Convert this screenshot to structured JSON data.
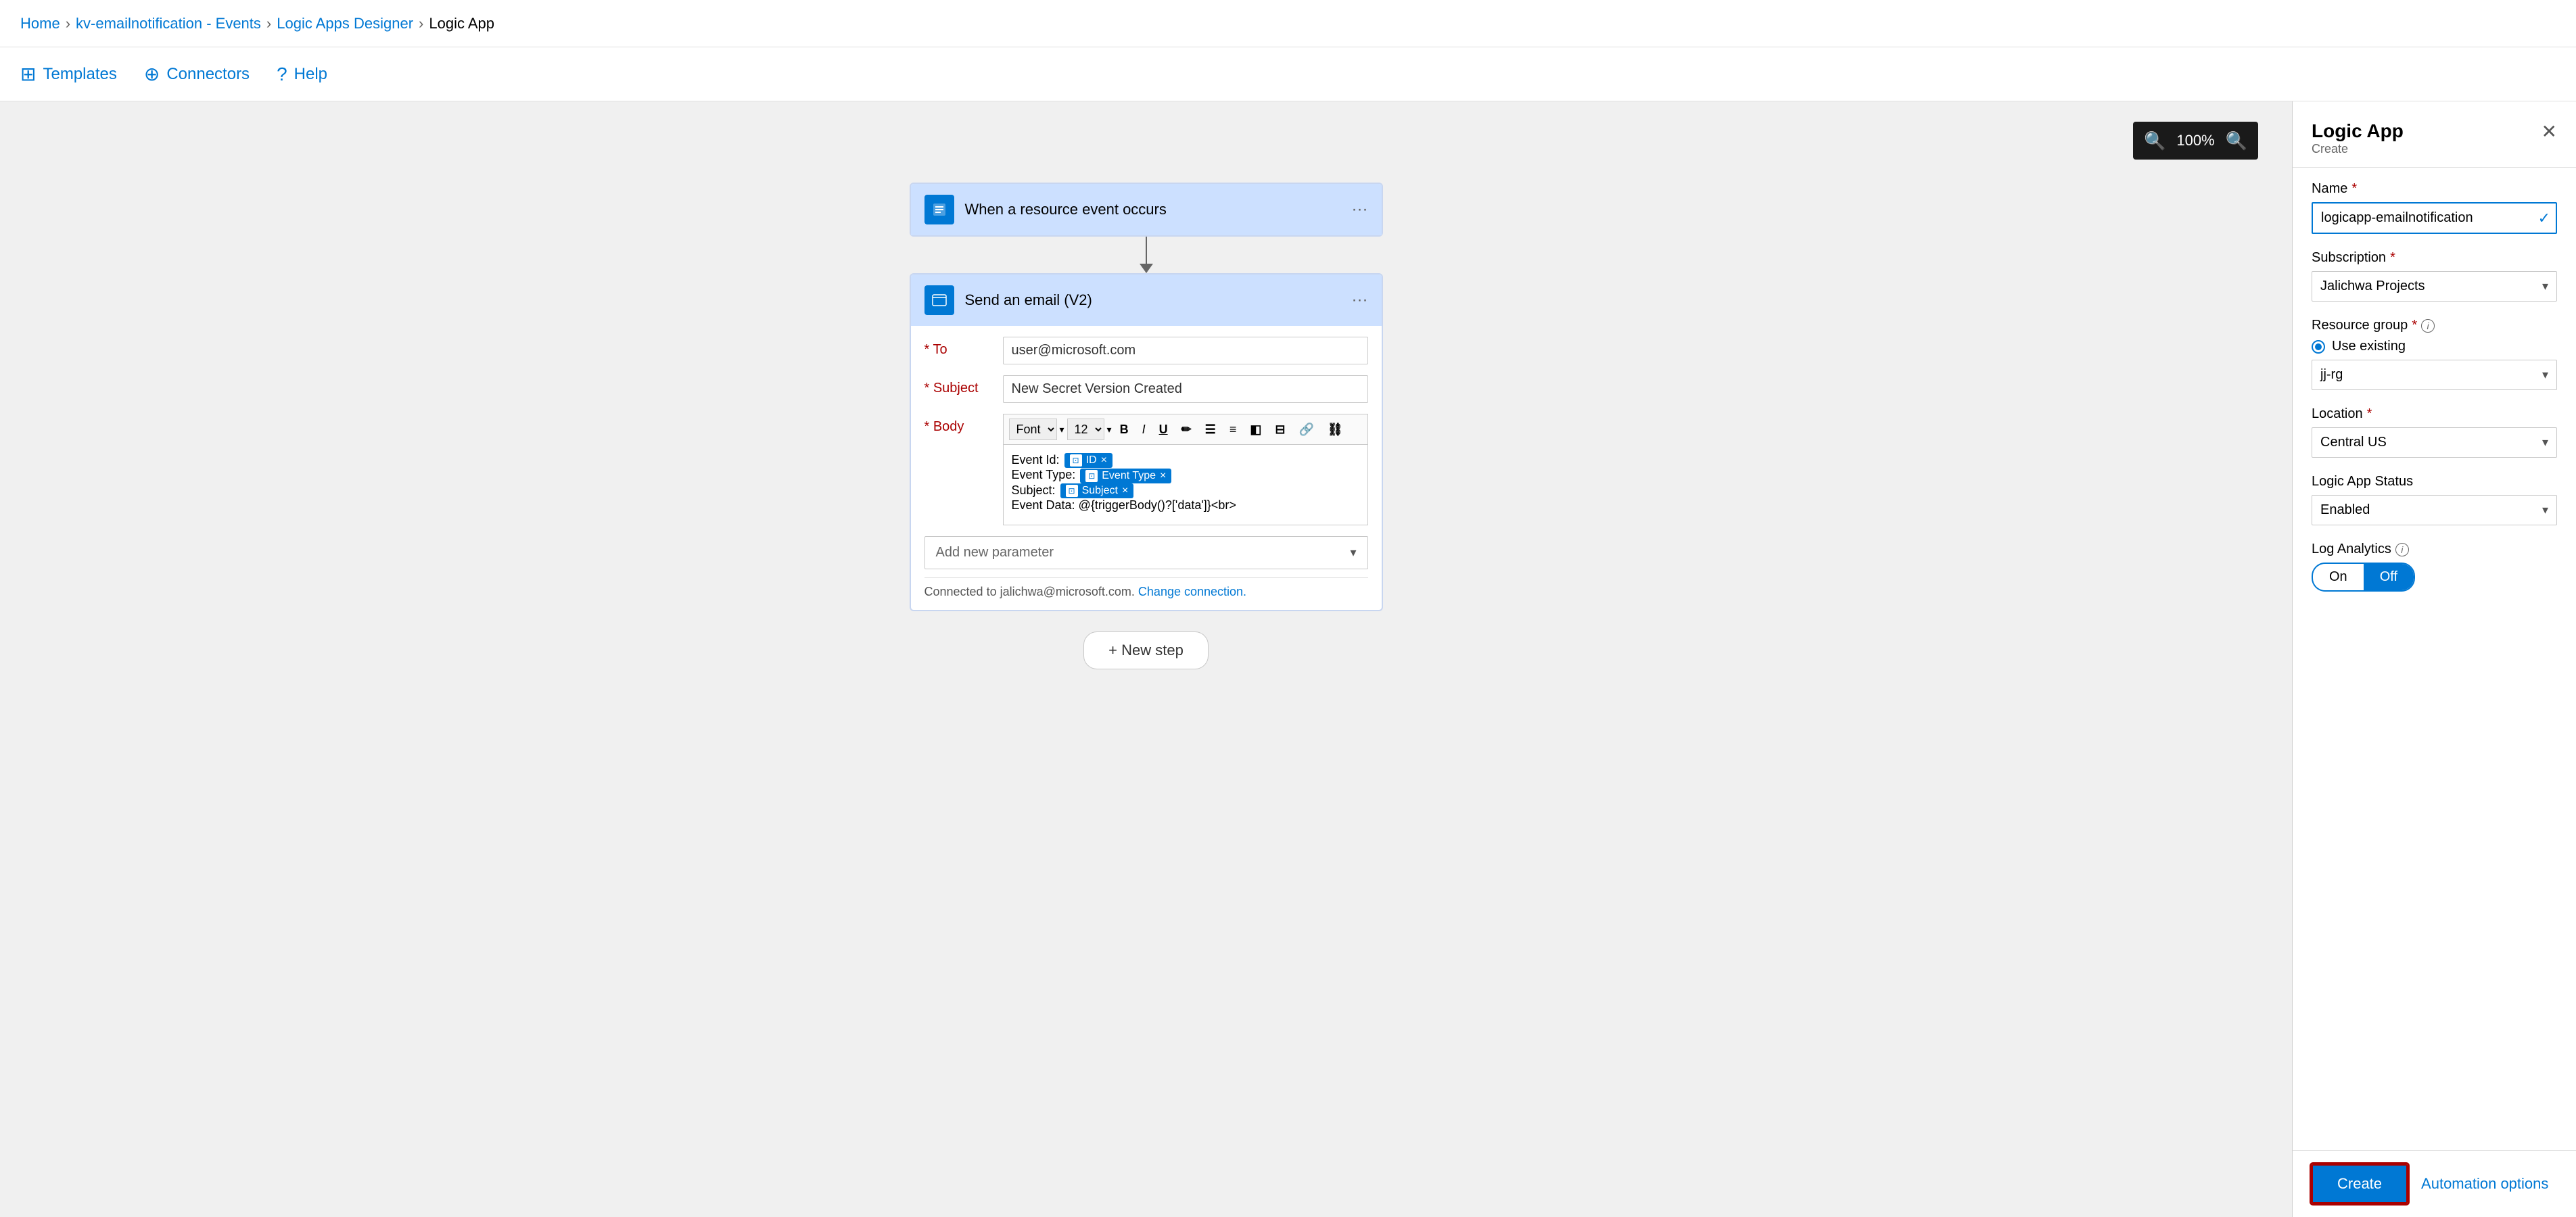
{
  "breadcrumb": {
    "items": [
      "Home",
      "kv-emailnotification - Events",
      "Logic Apps Designer",
      "Logic App"
    ]
  },
  "toolbar": {
    "templates_label": "Templates",
    "connectors_label": "Connectors",
    "help_label": "Help"
  },
  "canvas": {
    "zoom_level": "100%",
    "zoom_in_icon": "⊕",
    "zoom_out_icon": "⊖"
  },
  "flow": {
    "trigger_block": {
      "title": "When a resource event occurs",
      "more_icon": "···"
    },
    "action_block": {
      "title": "Send an email (V2)",
      "more_icon": "···",
      "to_label": "* To",
      "to_value": "user@microsoft.com",
      "subject_label": "* Subject",
      "subject_value": "New Secret Version Created",
      "body_label": "* Body",
      "body_toolbar": {
        "font_label": "Font",
        "size_label": "12",
        "bold": "B",
        "italic": "I",
        "underline": "U"
      },
      "body_content": {
        "event_id_prefix": "Event Id:",
        "event_id_tag": "ID",
        "event_type_prefix": "Event Type:",
        "event_type_tag": "Event Type",
        "subject_prefix": "Subject:",
        "subject_tag": "Subject",
        "event_data_line": "Event Data: @{triggerBody()?['data']}<br>"
      },
      "add_param_placeholder": "Add new parameter",
      "connected_text": "Connected to jalichwa@microsoft.com.",
      "change_connection_label": "Change connection."
    },
    "new_step_label": "+ New step"
  },
  "right_panel": {
    "title": "Logic App",
    "subtitle": "Create",
    "close_icon": "✕",
    "name_label": "Name",
    "name_value": "logicapp-emailnotification",
    "name_check": "✓",
    "subscription_label": "Subscription",
    "subscription_value": "Jalichwa Projects",
    "resource_group_label": "Resource group",
    "use_existing_label": "Use existing",
    "rg_value": "jj-rg",
    "location_label": "Location",
    "location_value": "Central US",
    "status_label": "Logic App Status",
    "status_value": "Enabled",
    "log_analytics_label": "Log Analytics",
    "log_on_label": "On",
    "log_off_label": "Off",
    "create_label": "Create",
    "automation_label": "Automation options"
  }
}
